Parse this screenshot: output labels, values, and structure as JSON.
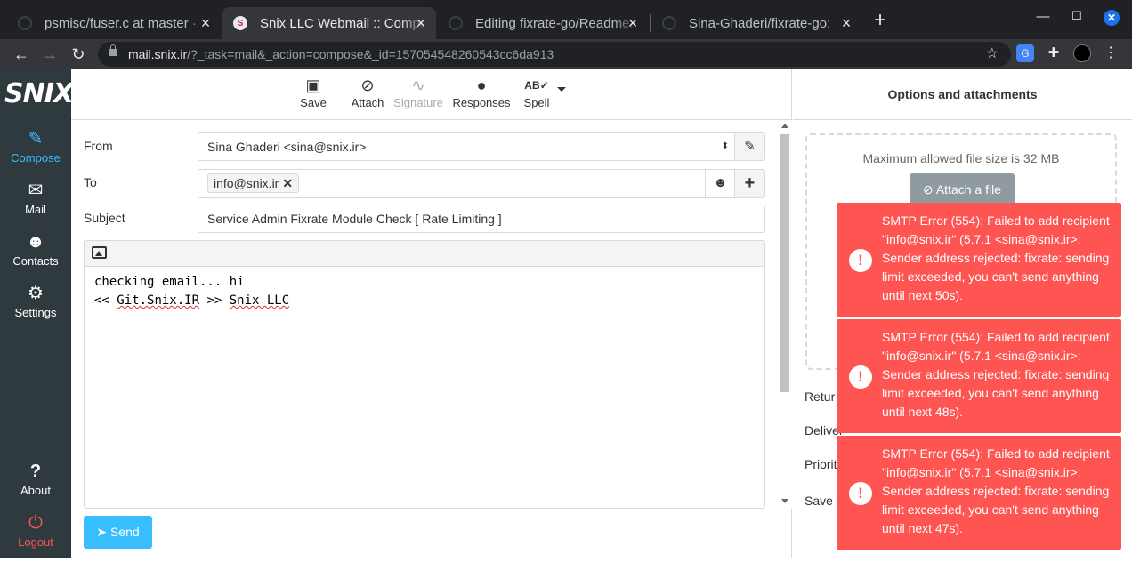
{
  "browser": {
    "tabs": [
      {
        "title": "psmisc/fuser.c at master · ",
        "favicon": "github-icon"
      },
      {
        "title": "Snix LLC Webmail :: Compose",
        "favicon": "snix-icon",
        "active": true
      },
      {
        "title": "Editing fixrate-go/Readme.md",
        "favicon": "github-icon"
      },
      {
        "title": "Sina-Ghaderi/fixrate-go: ",
        "favicon": "github-icon"
      }
    ],
    "url_host": "mail.snix.ir",
    "url_path": "/?_task=mail&_action=compose&_id=157054548260543cc6da913",
    "window_close": "✕"
  },
  "app": {
    "logo": "SNIX",
    "nav": [
      {
        "label": "Compose",
        "icon": "compose-icon"
      },
      {
        "label": "Mail",
        "icon": "envelope-icon"
      },
      {
        "label": "Contacts",
        "icon": "contacts-icon"
      },
      {
        "label": "Settings",
        "icon": "gear-icon"
      },
      {
        "label": "About",
        "icon": "question-icon"
      },
      {
        "label": "Logout",
        "icon": "power-icon"
      }
    ],
    "toolbar": {
      "save": "Save",
      "attach": "Attach",
      "signature": "Signature",
      "responses": "Responses",
      "spell": "Spell"
    },
    "form": {
      "from_label": "From",
      "from_value": "Sina Ghaderi <sina@snix.ir>",
      "to_label": "To",
      "recipient": "info@snix.ir",
      "subject_label": "Subject",
      "subject_value": "Service Admin Fixrate Module Check [ Rate Limiting ]",
      "body_line1": "checking email... hi",
      "body_line2_pre": "<< ",
      "body_line2_link1": "Git.Snix.IR",
      "body_line2_mid": " >> ",
      "body_line2_link2": "Snix LLC"
    },
    "send": "Send",
    "options": {
      "title": "Options and attachments",
      "max_size": "Maximum allowed file size is 32 MB",
      "attach_button": "Attach a file",
      "return_receipt": "Retur",
      "dsn": "Deliver",
      "priority": "Priorit",
      "save_sent": "Save s"
    },
    "errors": [
      {
        "message": "SMTP Error (554): Failed to add recipient \"info@snix.ir\" (5.7.1 <sina@snix.ir>: Sender address rejected: fixrate: sending limit exceeded, you can't send anything until next 50s)."
      },
      {
        "message": "SMTP Error (554): Failed to add recipient \"info@snix.ir\" (5.7.1 <sina@snix.ir>: Sender address rejected: fixrate: sending limit exceeded, you can't send anything until next 48s)."
      },
      {
        "message": "SMTP Error (554): Failed to add recipient \"info@snix.ir\" (5.7.1 <sina@snix.ir>: Sender address rejected: fixrate: sending limit exceeded, you can't send anything until next 47s)."
      }
    ]
  },
  "colors": {
    "accent": "#37beff",
    "sidebar": "#2f3a3f",
    "error": "#ff5552",
    "logout": "#ff5552"
  }
}
